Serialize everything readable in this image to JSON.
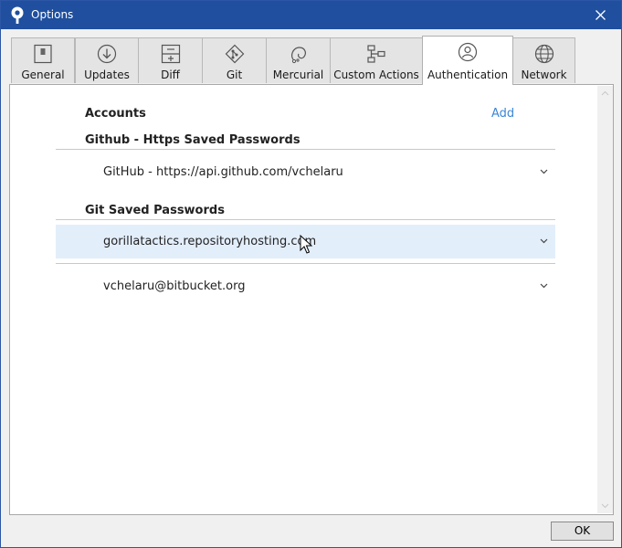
{
  "window": {
    "title": "Options",
    "app_icon": "sourcetree-icon",
    "close_icon": "close-icon"
  },
  "tabs": [
    {
      "label": "General",
      "icon": "toggle-switch-icon"
    },
    {
      "label": "Updates",
      "icon": "download-circle-icon"
    },
    {
      "label": "Diff",
      "icon": "diff-icon"
    },
    {
      "label": "Git",
      "icon": "git-icon"
    },
    {
      "label": "Mercurial",
      "icon": "mercurial-icon"
    },
    {
      "label": "Custom Actions",
      "icon": "custom-actions-icon"
    },
    {
      "label": "Authentication",
      "icon": "user-icon",
      "active": true
    },
    {
      "label": "Network",
      "icon": "globe-icon"
    }
  ],
  "accounts": {
    "heading": "Accounts",
    "add_label": "Add"
  },
  "github_section": {
    "heading": "Github - Https Saved Passwords",
    "items": [
      "GitHub - https://api.github.com/vchelaru"
    ]
  },
  "git_section": {
    "heading": "Git Saved Passwords",
    "items": [
      "gorillatactics.repositoryhosting.com",
      "vchelaru@bitbucket.org"
    ],
    "selected_index": 0
  },
  "footer": {
    "ok_label": "OK"
  },
  "colors": {
    "titlebar": "#1f4f9e",
    "link": "#3a86d6",
    "selected_row": "#e3eefb"
  }
}
